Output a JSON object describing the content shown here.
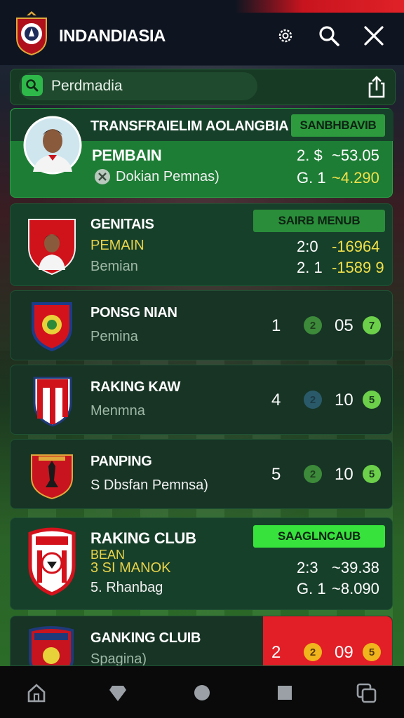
{
  "header": {
    "title": "INDANDIASIA",
    "icons": [
      "settings-icon",
      "search-icon",
      "close-icon"
    ]
  },
  "search": {
    "value": "Perdmadia"
  },
  "cards": [
    {
      "title": "TRANSFRAIELIM AOLANGBIA",
      "badge": "SANBHBAVIB",
      "line1": "PEMBAIN",
      "line2": "Dokian Pemnas)",
      "val1": "2. $",
      "val2": "~53.05",
      "val3": "G. 1",
      "val4": "~4.290"
    },
    {
      "title": "GENITAIS",
      "badge": "SAIRB MENUB",
      "line1": "PEMAIN",
      "line2": "Bemian",
      "val1": "2:0",
      "val2": "-16964",
      "val3": "2. 1",
      "val4": "-1589 9"
    },
    {
      "title": "PONSG NIAN",
      "line1": "Pemina",
      "rank": "1",
      "dot": "2",
      "score": "05",
      "icon": "7"
    },
    {
      "title": "RAKING KAW",
      "line1": "Menmna",
      "rank": "4",
      "dot": "2",
      "score": "10",
      "icon": "5"
    },
    {
      "title": "PANPING",
      "line1": "S Dbsfan Pemnsa)",
      "rank": "5",
      "dot": "2",
      "score": "10",
      "icon": "5"
    },
    {
      "title": "RAKING CLUB",
      "badge": "SAAGLNCAUB",
      "line1": "BEAN",
      "line1b": "3 SI MANOK",
      "line2": "5. Rhanbag",
      "val1": "2:3",
      "val2": "~39.38",
      "val3": "G. 1",
      "val4": "~8.090"
    },
    {
      "title": "GANKING CLUIB",
      "line1": "Spagina)",
      "rank": "2",
      "dot": "2",
      "score": "09",
      "icon": "5"
    }
  ],
  "nav": [
    "home-icon",
    "diamond-icon",
    "circle-icon",
    "square-icon",
    "multiwindow-icon"
  ]
}
